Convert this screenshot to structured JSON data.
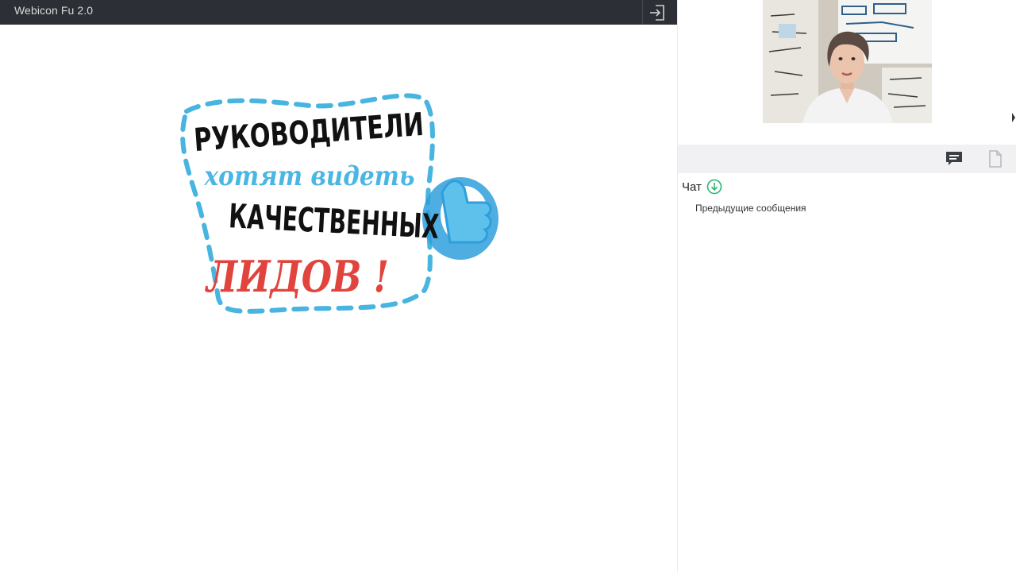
{
  "app": {
    "title": "Webicon Fu 2.0"
  },
  "toolbar": {
    "exit_icon": "exit-icon"
  },
  "slide": {
    "line1": "РУКОВОДИТЕЛИ",
    "line2": "хотят видеть",
    "line3": "КАЧЕСТВЕННЫХ",
    "line4": "ЛИДОВ !",
    "colors": {
      "border": "#48b4e0",
      "black_text": "#111111",
      "blue_text": "#4ab6e4",
      "red_text": "#e0443c",
      "thumb": "#2f9fdc"
    }
  },
  "video": {
    "icon": "presenter-video"
  },
  "panel": {
    "chat_tab_icon": "chat-icon",
    "files_tab_icon": "file-icon"
  },
  "chat": {
    "title": "Чат",
    "scroll_icon": "arrow-down-circle-icon",
    "previous_messages": "Предыдущие сообщения",
    "accent": "#2bb673"
  }
}
